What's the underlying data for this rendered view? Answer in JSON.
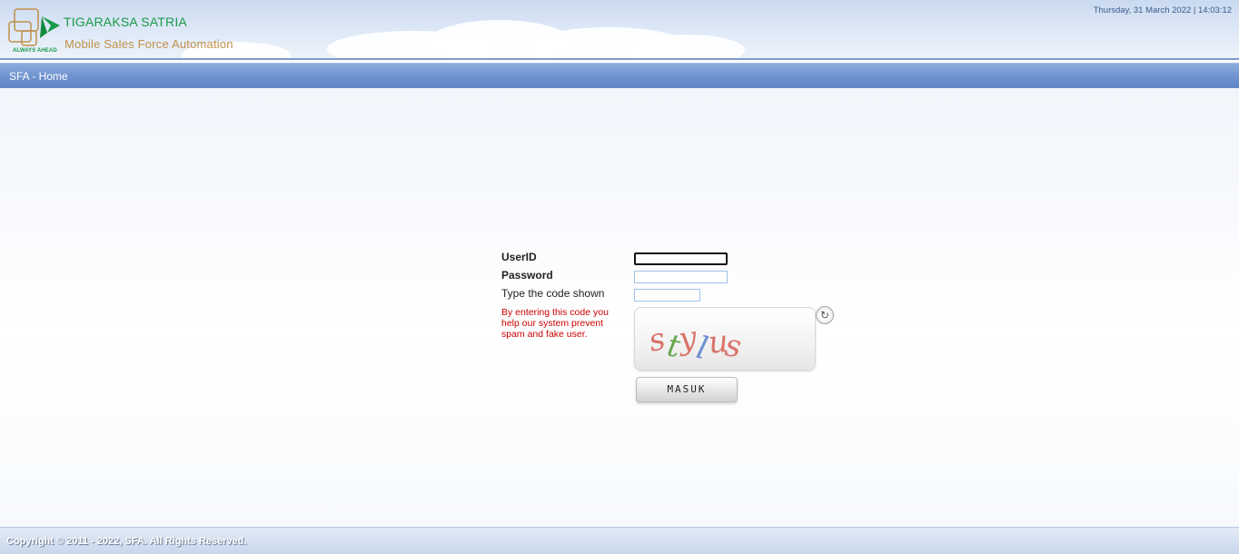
{
  "header": {
    "brand_title": "TIGARAKSA SATRIA",
    "brand_subtitle": "Mobile Sales Force Automation",
    "brand_tagline": "ALWAYS AHEAD",
    "datetime": "Thursday, 31 March 2022 | 14:03:12"
  },
  "nav": {
    "title": "SFA - Home"
  },
  "login": {
    "userid_label": "UserID",
    "userid_value": "",
    "password_label": "Password",
    "password_value": "",
    "code_label": "Type the code shown",
    "code_value": "",
    "note": "By entering this code you help our system prevent spam and fake user.",
    "captcha_text": "stylus",
    "submit_label": "MASUK",
    "refresh_icon": "refresh-icon"
  },
  "footer": {
    "copyright": "Copyright © 2011 - 2022, SFA. All Rights Reserved."
  },
  "colors": {
    "brand_green": "#1a9a4a",
    "brand_gold": "#c0904a",
    "nav_blue": "#6d92cf",
    "note_red": "#cc0000"
  }
}
